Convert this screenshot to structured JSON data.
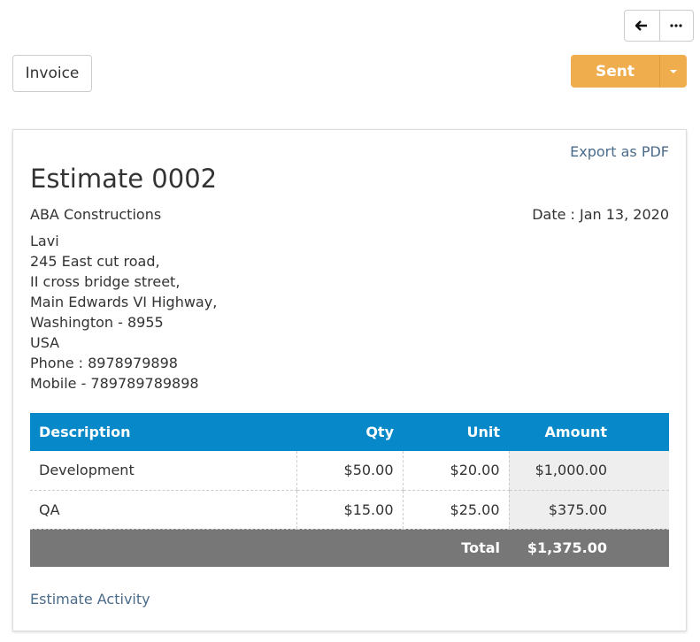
{
  "toolbar": {
    "back_icon": "arrow-left-icon",
    "more_icon": "ellipsis-icon",
    "invoice_label": "Invoice",
    "status_label": "Sent",
    "status_color": "#f0ad4e"
  },
  "estimate": {
    "export_label": "Export as PDF",
    "title": "Estimate 0002",
    "company": "ABA Constructions",
    "date": "Date : Jan 13, 2020",
    "address_lines": [
      "Lavi",
      "245 East cut road,",
      "II cross bridge street,",
      "Main Edwards VI Highway,",
      "Washington - 8955",
      "USA",
      "Phone : 8978979898",
      "Mobile - 789789789898"
    ],
    "table": {
      "headers": {
        "description": "Description",
        "qty": "Qty",
        "unit": "Unit",
        "amount": "Amount"
      },
      "rows": [
        {
          "description": "Development",
          "qty": "$50.00",
          "unit": "$20.00",
          "amount": "$1,000.00"
        },
        {
          "description": "QA",
          "qty": "$15.00",
          "unit": "$25.00",
          "amount": "$375.00"
        }
      ],
      "total_label": "Total",
      "total_value": "$1,375.00"
    },
    "activity_label": "Estimate Activity"
  },
  "colors": {
    "header_blue": "#0688c9",
    "total_gray": "#777777",
    "link": "#4b6b8a"
  }
}
